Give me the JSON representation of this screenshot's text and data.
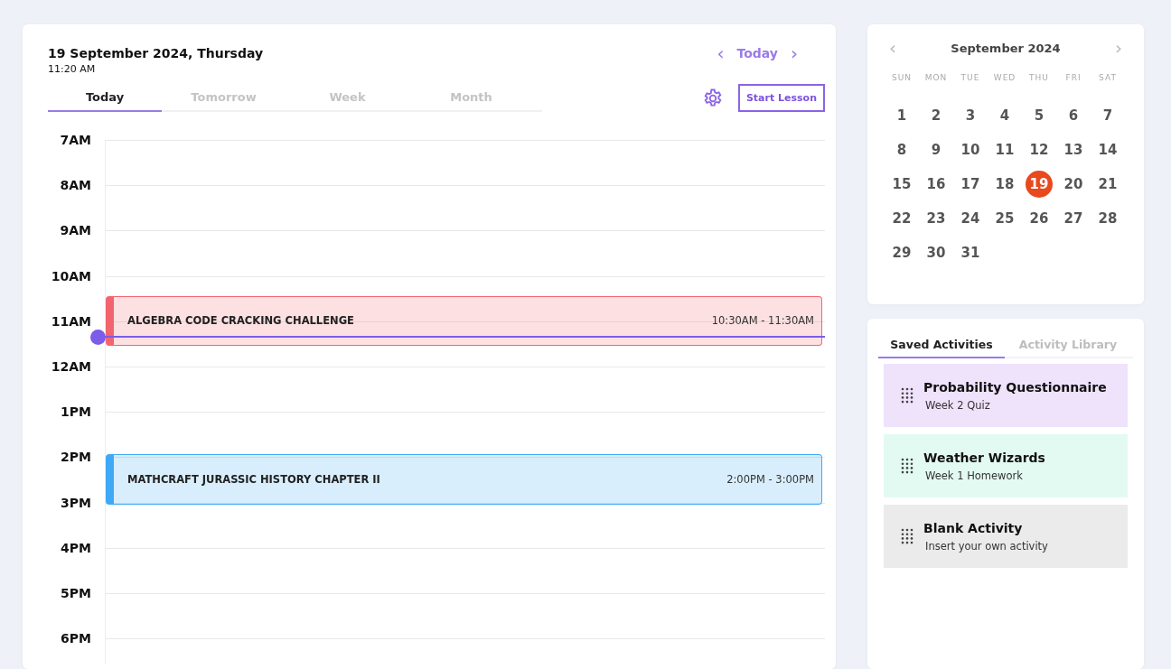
{
  "header": {
    "date": "19 September 2024, Thursday",
    "time": "11:20 AM"
  },
  "nav": {
    "prev": "‹",
    "label": "Today",
    "next": "›"
  },
  "view_tabs": [
    {
      "label": "Today",
      "selected": true
    },
    {
      "label": "Tomorrow",
      "selected": false
    },
    {
      "label": "Week",
      "selected": false
    },
    {
      "label": "Month",
      "selected": false
    }
  ],
  "start_button": "Start Lesson",
  "hours": [
    "7AM",
    "8AM",
    "9AM",
    "10AM",
    "11AM",
    "12AM",
    "1PM",
    "2PM",
    "3PM",
    "4PM",
    "5PM",
    "6PM"
  ],
  "events": [
    {
      "title": "ALGEBRA CODE CRACKING CHALLENGE",
      "time": "10:30AM - 11:30AM",
      "color": "#f2656f"
    },
    {
      "title": "MATHCRAFT JURASSIC HISTORY CHAPTER II",
      "time": "2:00PM - 3:00PM",
      "color": "#3fa9f5"
    }
  ],
  "mini_calendar": {
    "prev": "‹",
    "month": "September 2024",
    "next": "›",
    "weekdays": [
      "SUN",
      "MON",
      "TUE",
      "WED",
      "THU",
      "FRI",
      "SAT"
    ],
    "days": [
      {
        "label": "1",
        "selected": false
      },
      {
        "label": "2",
        "selected": false
      },
      {
        "label": "3",
        "selected": false
      },
      {
        "label": "4",
        "selected": false
      },
      {
        "label": "5",
        "selected": false
      },
      {
        "label": "6",
        "selected": false
      },
      {
        "label": "7",
        "selected": false
      },
      {
        "label": "8",
        "selected": false
      },
      {
        "label": "9",
        "selected": false
      },
      {
        "label": "10",
        "selected": false
      },
      {
        "label": "11",
        "selected": false
      },
      {
        "label": "12",
        "selected": false
      },
      {
        "label": "13",
        "selected": false
      },
      {
        "label": "14",
        "selected": false
      },
      {
        "label": "15",
        "selected": false
      },
      {
        "label": "16",
        "selected": false
      },
      {
        "label": "17",
        "selected": false
      },
      {
        "label": "18",
        "selected": false
      },
      {
        "label": "19",
        "selected": true
      },
      {
        "label": "20",
        "selected": false
      },
      {
        "label": "21",
        "selected": false
      },
      {
        "label": "22",
        "selected": false
      },
      {
        "label": "23",
        "selected": false
      },
      {
        "label": "24",
        "selected": false
      },
      {
        "label": "25",
        "selected": false
      },
      {
        "label": "26",
        "selected": false
      },
      {
        "label": "27",
        "selected": false
      },
      {
        "label": "28",
        "selected": false
      },
      {
        "label": "29",
        "selected": false
      },
      {
        "label": "30",
        "selected": false
      },
      {
        "label": "31",
        "selected": false
      }
    ]
  },
  "activity_tabs": [
    {
      "label": "Saved Activities",
      "selected": true
    },
    {
      "label": "Activity Library",
      "selected": false
    }
  ],
  "activities": [
    {
      "title": "Probability Questionnaire",
      "subtitle": "Week 2 Quiz",
      "color": "#efe2fb"
    },
    {
      "title": "Weather Wizards",
      "subtitle": "Week 1 Homework",
      "color": "#e3faf2"
    },
    {
      "title": "Blank Activity",
      "subtitle": "Insert your own activity",
      "color": "#ebebeb"
    }
  ]
}
